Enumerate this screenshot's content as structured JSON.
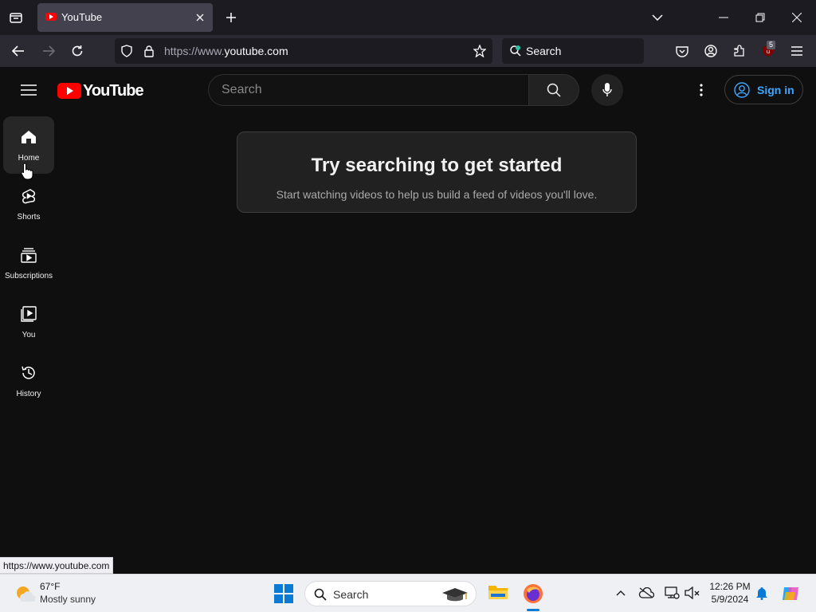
{
  "browser": {
    "tab_title": "YouTube",
    "url_dim": "https://www.",
    "url_main": "youtube.com",
    "search_label": "Search",
    "extension_badge": "5",
    "status_url": "https://www.youtube.com"
  },
  "youtube": {
    "logo_text": "YouTube",
    "search_placeholder": "Search",
    "sign_in_label": "Sign in",
    "guide": [
      {
        "label": "Home"
      },
      {
        "label": "Shorts"
      },
      {
        "label": "Subscriptions"
      },
      {
        "label": "You"
      },
      {
        "label": "History"
      }
    ],
    "empty_state": {
      "heading": "Try searching to get started",
      "subtext": "Start watching videos to help us build a feed of videos you'll love."
    }
  },
  "taskbar": {
    "weather_temp": "67°F",
    "weather_desc": "Mostly sunny",
    "search_label": "Search",
    "time": "12:26 PM",
    "date": "5/9/2024"
  },
  "colors": {
    "youtube_red": "#ff0000",
    "sign_in_blue": "#3ea6ff",
    "page_bg": "#0f0f0f"
  }
}
